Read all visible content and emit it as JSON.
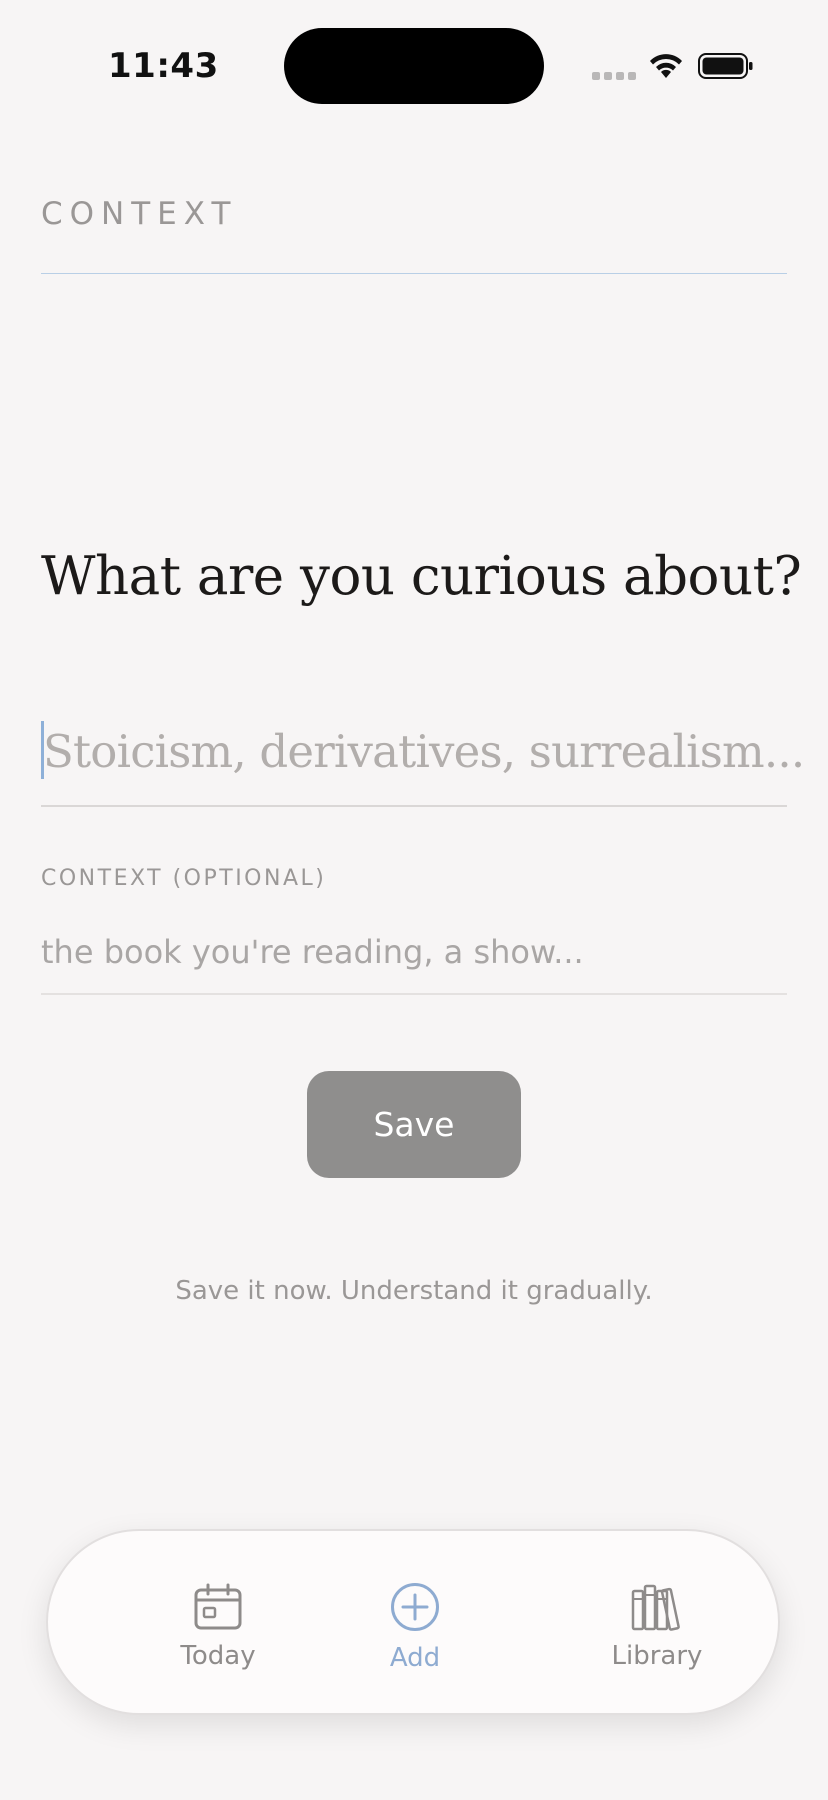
{
  "status_bar": {
    "time": "11:43"
  },
  "header": {
    "label": "CONTEXT"
  },
  "main": {
    "question": "What are you curious about?",
    "topic_placeholder": "Stoicism, derivatives, surrealism...",
    "context_label": "CONTEXT (OPTIONAL)",
    "context_placeholder": "the book you're reading, a show...",
    "save_label": "Save",
    "tagline": "Save it now. Understand it gradually."
  },
  "tab_bar": {
    "items": [
      {
        "label": "Today",
        "icon": "calendar-icon",
        "active": false
      },
      {
        "label": "Add",
        "icon": "plus-circle-icon",
        "active": true
      },
      {
        "label": "Library",
        "icon": "books-icon",
        "active": false
      }
    ]
  },
  "colors": {
    "background": "#f7f5f5",
    "accent": "#8eabd1",
    "save_button": "#8f8e8d",
    "muted_text": "#9a9796"
  }
}
